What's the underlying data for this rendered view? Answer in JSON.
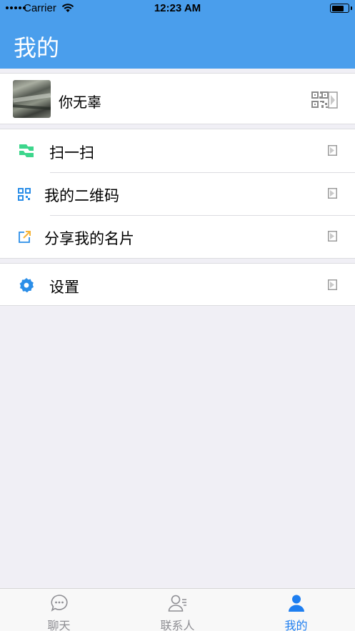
{
  "status_bar": {
    "carrier": "Carrier",
    "time": "12:23 AM"
  },
  "header": {
    "title": "我的"
  },
  "profile": {
    "name": "你无辜"
  },
  "menu": [
    {
      "label": "扫一扫",
      "icon": "scan-icon"
    },
    {
      "label": "我的二维码",
      "icon": "qr-code-icon"
    },
    {
      "label": "分享我的名片",
      "icon": "share-icon"
    }
  ],
  "settings": {
    "label": "设置",
    "icon": "gear-icon"
  },
  "tabbar": {
    "tabs": [
      {
        "label": "聊天",
        "icon": "chat-icon",
        "active": false
      },
      {
        "label": "联系人",
        "icon": "contacts-icon",
        "active": false
      },
      {
        "label": "我的",
        "icon": "person-icon",
        "active": true
      }
    ]
  },
  "colors": {
    "accent": "#4a9eec",
    "active_tab": "#1e7ef0",
    "scan_green": "#3dd68c",
    "background": "#f0eff5"
  }
}
